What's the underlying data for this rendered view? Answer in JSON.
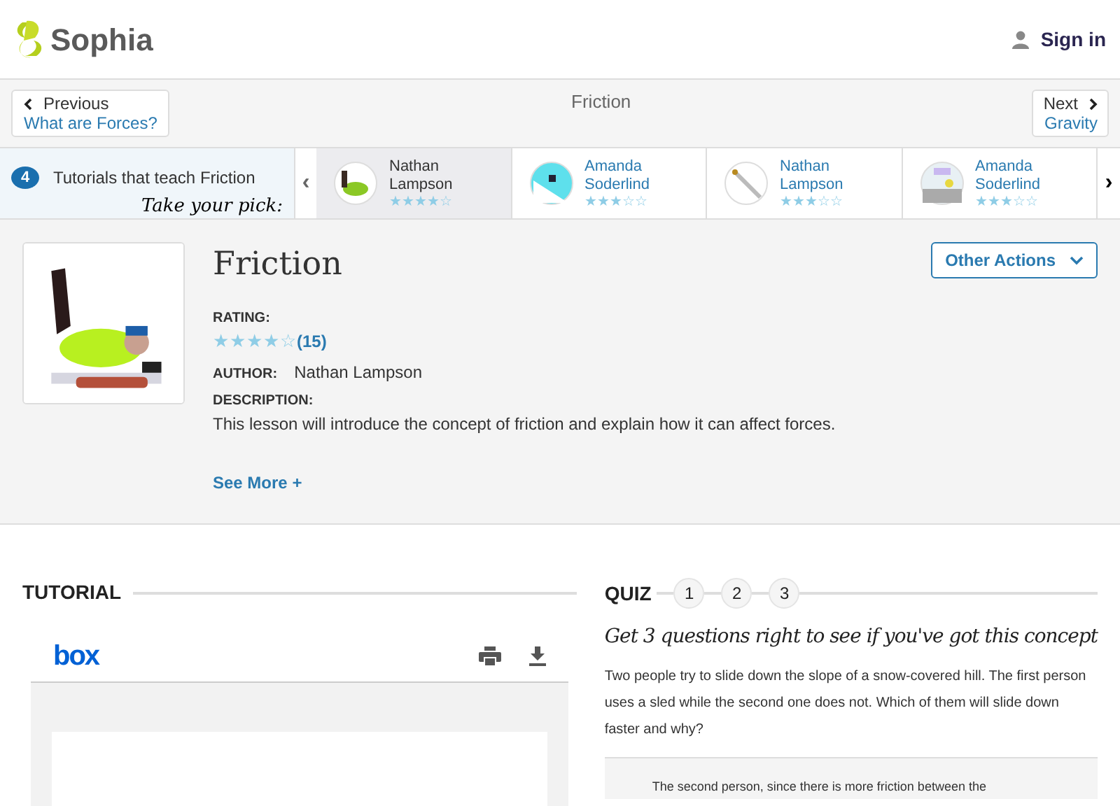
{
  "header": {
    "logo": "Sophia",
    "sign_in": "Sign in"
  },
  "nav": {
    "previous_label": "Previous",
    "previous_title": "What are Forces?",
    "current": "Friction",
    "next_label": "Next",
    "next_title": "Gravity"
  },
  "tutorials": {
    "count": "4",
    "label": "Tutorials that teach Friction",
    "tagline": "Take your pick:",
    "prev": "‹",
    "next": "›",
    "items": [
      {
        "author": "Nathan Lampson",
        "stars": 4,
        "selected": true
      },
      {
        "author": "Amanda Soderlind",
        "stars": 3,
        "selected": false
      },
      {
        "author": "Nathan Lampson",
        "stars": 3,
        "selected": false
      },
      {
        "author": "Amanda Soderlind",
        "stars": 3,
        "selected": false
      }
    ]
  },
  "lesson": {
    "title": "Friction",
    "other_actions": "Other Actions",
    "rating_label": "RATING:",
    "stars": 4,
    "rating_count": "(15)",
    "author_label": "AUTHOR:",
    "author": "Nathan Lampson",
    "description_label": "DESCRIPTION:",
    "description": "This lesson will introduce the concept of friction and explain how it can affect forces.",
    "see_more": "See More +"
  },
  "tutorial": {
    "heading": "TUTORIAL",
    "viewer_logo": "box"
  },
  "quiz": {
    "heading": "QUIZ",
    "steps": [
      {
        "label": "1"
      },
      {
        "label": "2"
      },
      {
        "label": "3"
      }
    ],
    "prompt": "Get 3 questions right to see if you've got this concept",
    "question": "Two people try to slide down the slope of a snow-covered hill. The first person uses a sled while the second one does not. Which of them will slide down faster and why?",
    "answer": "The second person, since there is more friction between the"
  }
}
